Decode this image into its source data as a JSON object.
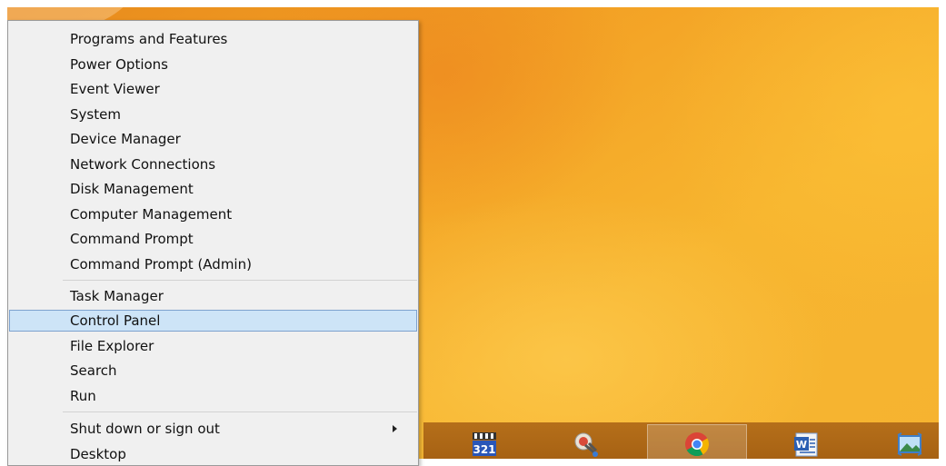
{
  "menu": {
    "items": [
      {
        "label": "Programs and Features"
      },
      {
        "label": "Power Options"
      },
      {
        "label": "Event Viewer"
      },
      {
        "label": "System"
      },
      {
        "label": "Device Manager"
      },
      {
        "label": "Network Connections"
      },
      {
        "label": "Disk Management"
      },
      {
        "label": "Computer Management"
      },
      {
        "label": "Command Prompt"
      },
      {
        "label": "Command Prompt (Admin)"
      },
      {
        "label": "Task Manager"
      },
      {
        "label": "Control Panel",
        "selected": true
      },
      {
        "label": "File Explorer"
      },
      {
        "label": "Search"
      },
      {
        "label": "Run"
      },
      {
        "label": "Shut down or sign out",
        "has_submenu": true
      },
      {
        "label": "Desktop"
      }
    ]
  },
  "taskbar": {
    "apps": [
      {
        "icon": "media-player-classic-icon",
        "badge_text": "321"
      },
      {
        "icon": "snipping-tool-icon"
      },
      {
        "icon": "chrome-icon",
        "active": true
      },
      {
        "icon": "word-icon",
        "badge_text": "W"
      },
      {
        "icon": "photos-icon"
      }
    ]
  },
  "colors": {
    "desktop_accent": "#f3a225",
    "menu_background": "#f0f0f0",
    "selection": "#cde4f7",
    "selection_border": "#7da2ce"
  }
}
